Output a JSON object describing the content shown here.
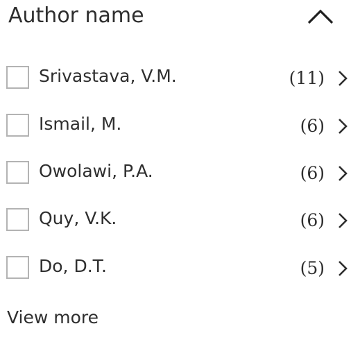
{
  "filter": {
    "title": "Author name",
    "collapse_icon": "chevron-up-icon",
    "items": [
      {
        "label": "Srivastava, V.M.",
        "count": "(11)",
        "checked": false
      },
      {
        "label": "Ismail, M.",
        "count": "(6)",
        "checked": false
      },
      {
        "label": "Owolawi, P.A.",
        "count": "(6)",
        "checked": false
      },
      {
        "label": "Quy, V.K.",
        "count": "(6)",
        "checked": false
      },
      {
        "label": "Do, D.T.",
        "count": "(5)",
        "checked": false
      }
    ],
    "item_icon": "chevron-right-icon",
    "view_more_label": "View more"
  },
  "colors": {
    "text": "#2e2e2e",
    "checkbox_border": "#b3b3b3",
    "background": "#ffffff"
  }
}
